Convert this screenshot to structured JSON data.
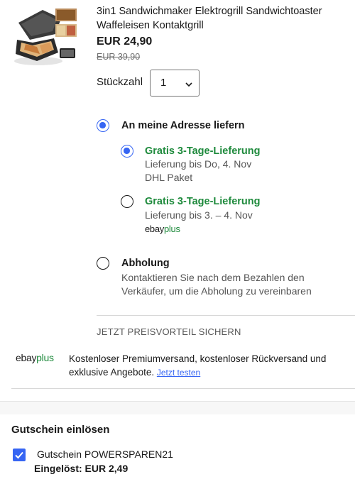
{
  "product": {
    "title": "3in1 Sandwichmaker Elektrogrill Sandwichtoaster Waffeleisen Kontaktgrill",
    "price": "EUR 24,90",
    "old_price": "EUR 39,90",
    "image_icon": "sandwich-maker-image"
  },
  "quantity": {
    "label": "Stückzahl",
    "value": "1"
  },
  "delivery": {
    "address_option": {
      "label": "An meine Adresse liefern",
      "selected": true
    },
    "shipping_options": [
      {
        "title": "Gratis 3-Tage-Lieferung",
        "line1": "Lieferung bis Do, 4. Nov",
        "line2": "DHL Paket",
        "selected": true
      },
      {
        "title": "Gratis 3-Tage-Lieferung",
        "line1": "Lieferung bis 3. – 4. Nov",
        "badge_ebay": "ebay",
        "badge_plus": "plus",
        "selected": false
      }
    ],
    "pickup_option": {
      "label": "Abholung",
      "desc_line1": "Kontaktieren Sie nach dem Bezahlen den",
      "desc_line2": "Verkäufer, um die Abholung zu vereinbaren",
      "selected": false
    }
  },
  "promo": {
    "heading": "JETZT PREISVORTEIL SICHERN",
    "logo_ebay": "ebay",
    "logo_plus": "plus",
    "text": "Kostenloser Premiumversand, kostenloser Rückversand und exklusive Angebote.",
    "link": "Jetzt testen"
  },
  "voucher": {
    "title": "Gutschein einlösen",
    "name": "Gutschein POWERSPAREN21",
    "applied": "Eingelöst: EUR 2,49",
    "checked": true
  },
  "colors": {
    "accent": "#3665f3",
    "green": "#1e8a3c",
    "text": "#191919",
    "muted": "#555555"
  }
}
